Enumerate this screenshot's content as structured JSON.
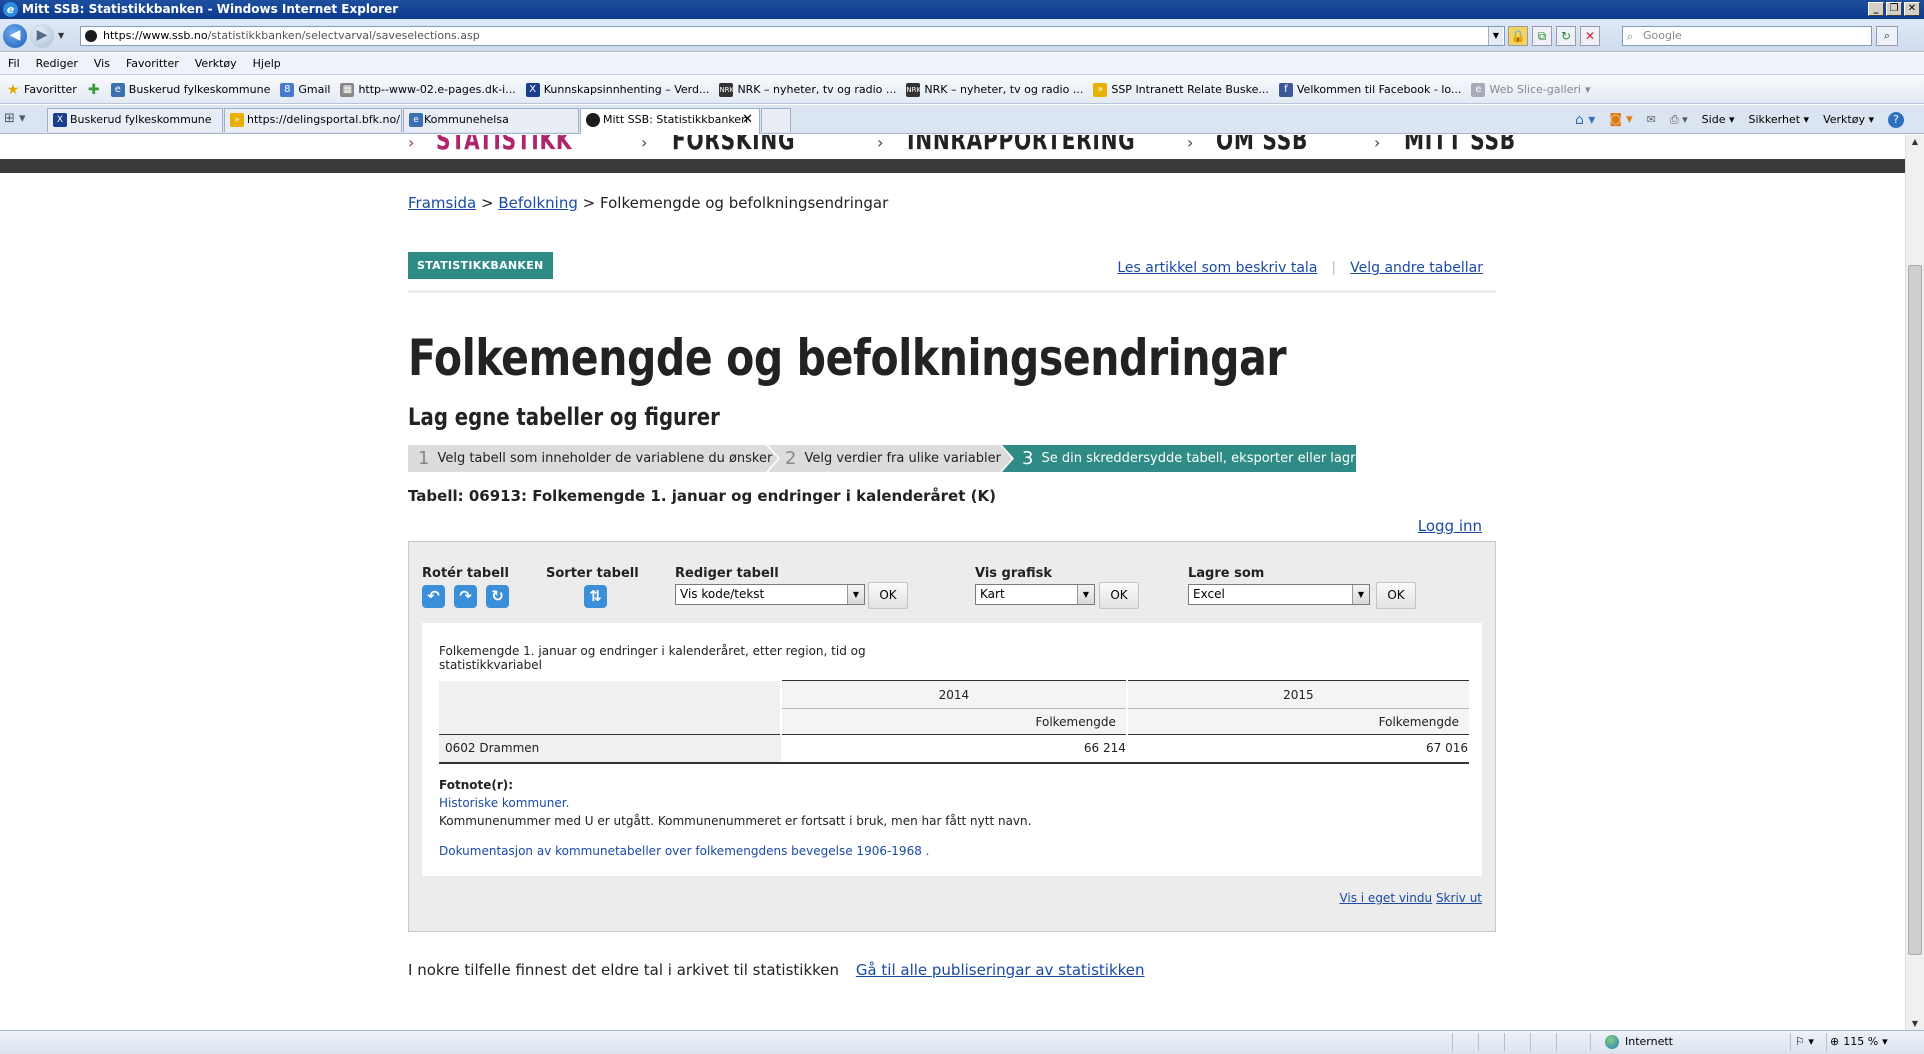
{
  "window": {
    "title": "Mitt SSB: Statistikkbanken - Windows Internet Explorer",
    "buttons": [
      "_",
      "❐",
      "✕"
    ]
  },
  "address": {
    "url_host": "https://www.ssb.no",
    "url_path": "/statistikkbanken/selectvarval/saveselections.asp",
    "search_placeholder": "Google"
  },
  "menu": [
    "Fil",
    "Rediger",
    "Vis",
    "Favoritter",
    "Verktøy",
    "Hjelp"
  ],
  "favorites": {
    "label": "Favoritter",
    "items": [
      "Buskerud fylkeskommune",
      "Gmail",
      "http--www-02.e-pages.dk-i...",
      "Kunnskapsinnhenting – Verd...",
      "NRK – nyheter, tv og radio ...",
      "NRK – nyheter, tv og radio ...",
      "SSP Intranett Relate  Buske...",
      "Velkommen til Facebook - lo...",
      "Web Slice-galleri"
    ]
  },
  "tabs": [
    {
      "label": "Buskerud fylkeskommune"
    },
    {
      "label": "https://delingsportal.bfk.no/..."
    },
    {
      "label": "Kommunehelsa"
    },
    {
      "label": "Mitt SSB: Statistikkbanken"
    }
  ],
  "commandbar": [
    "Side",
    "Sikkerhet",
    "Verktøy"
  ],
  "site_nav": [
    "STATISTIKK",
    "FORSKING",
    "INNRAPPORTERING",
    "OM SSB",
    "MITT SSB"
  ],
  "breadcrumb": {
    "home": "Framsida",
    "section": "Befolkning",
    "current": "Folkemengde og befolkningsendringar",
    "sep": ">"
  },
  "badge": "STATISTIKKBANKEN",
  "top_links": {
    "article": "Les artikkel som beskriv tala",
    "other_tables": "Velg andre tabellar"
  },
  "page_title": "Folkemengde og befolkningsendringar",
  "subtitle": "Lag egne tabeller og figurer",
  "steps": [
    {
      "num": "1",
      "label": "Velg tabell som inneholder de variablene du ønsker"
    },
    {
      "num": "2",
      "label": "Velg verdier fra ulike variabler"
    },
    {
      "num": "3",
      "label": "Se din skreddersydde tabell, eksporter eller lagre"
    }
  ],
  "table_heading": "Tabell: 06913: Folkemengde 1. januar og endringer i kalenderåret (K)",
  "login_link": "Logg inn",
  "controls": {
    "rotate": {
      "label": "Rotér tabell"
    },
    "sort": {
      "label": "Sorter tabell"
    },
    "edit": {
      "label": "Rediger tabell",
      "value": "Vis kode/tekst",
      "ok": "OK"
    },
    "chart": {
      "label": "Vis grafisk",
      "value": "Kart",
      "ok": "OK"
    },
    "save": {
      "label": "Lagre som",
      "value": "Excel",
      "ok": "OK"
    }
  },
  "table": {
    "caption": "Folkemengde 1. januar og endringer i kalenderåret, etter region, tid og statistikkvariabel",
    "years": [
      "2014",
      "2015"
    ],
    "variable": "Folkemengde",
    "rows": [
      {
        "region": "0602 Drammen",
        "values": [
          "66 214",
          "67 016"
        ]
      }
    ]
  },
  "footnotes": {
    "title": "Fotnote(r):",
    "link": "Historiske kommuner.",
    "text": "Kommunenummer med U er utgått. Kommunenummeret er fortsatt i bruk, men har fått nytt navn.",
    "doc_link": "Dokumentasjon av kommunetabeller over folkemengdens bevegelse 1906-1968 ."
  },
  "panel_links": {
    "own_window": "Vis i eget vindu",
    "print": "Skriv ut"
  },
  "archive": {
    "text": "I nokre tilfelle finnest det eldre tal i arkivet til statistikken",
    "link": "Gå til alle publiseringar av statistikken"
  },
  "status": {
    "zone": "Internett",
    "zoom": "115 %"
  },
  "colors": {
    "accent_teal": "#2f8b85",
    "active_nav": "#b0246b",
    "link": "#1a4aa6",
    "icon_blue": "#3a8fd8"
  }
}
